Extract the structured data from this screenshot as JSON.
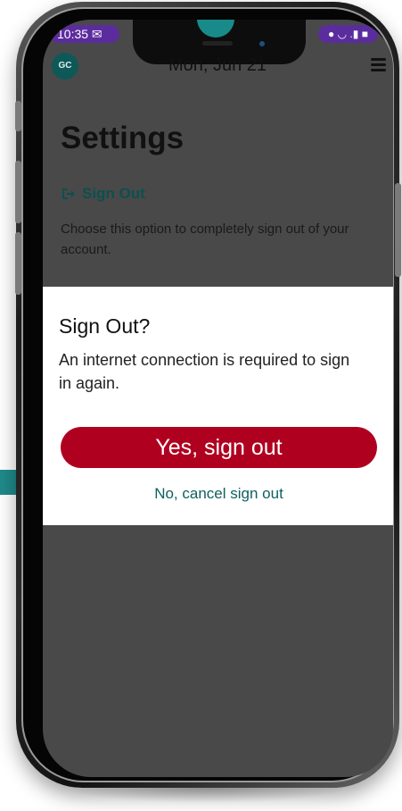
{
  "status": {
    "time_label": "10:35 ✉",
    "right_icons": "● ◡ .▮ ■"
  },
  "header": {
    "avatar_initials": "GC",
    "date": "Mon, Jun 21",
    "menu_icon": "hamburger-menu-icon"
  },
  "settings": {
    "title": "Settings",
    "signout_label": "Sign Out",
    "signout_icon": "sign-out-icon",
    "description": "Choose this option to completely sign out of your account."
  },
  "dialog": {
    "title": "Sign Out?",
    "message": "An internet connection is required to sign in again.",
    "confirm_label": "Yes, sign out",
    "cancel_label": "No, cancel sign out"
  },
  "colors": {
    "teal_accent": "#1f8a8a",
    "status_purple": "#5b2c9d",
    "overlay_gray": "#494949",
    "link_teal": "#106060",
    "confirm_red": "#b00020"
  }
}
